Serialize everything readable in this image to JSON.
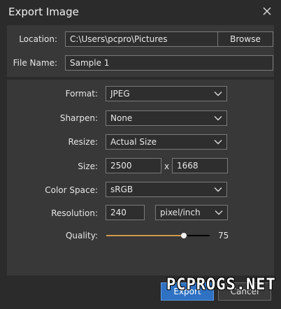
{
  "window": {
    "title": "Export Image"
  },
  "location": {
    "label": "Location:",
    "value": "C:\\Users\\pcpro\\Pictures",
    "browse_label": "Browse"
  },
  "file_name": {
    "label": "File Name:",
    "value": "Sample 1"
  },
  "format": {
    "label": "Format:",
    "value": "JPEG"
  },
  "sharpen": {
    "label": "Sharpen:",
    "value": "None"
  },
  "resize": {
    "label": "Resize:",
    "value": "Actual Size"
  },
  "size": {
    "label": "Size:",
    "width": "2500",
    "separator": "x",
    "height": "1668"
  },
  "color_space": {
    "label": "Color Space:",
    "value": "sRGB"
  },
  "resolution": {
    "label": "Resolution:",
    "value": "240",
    "unit": "pixel/inch"
  },
  "quality": {
    "label": "Quality:",
    "value": "75",
    "level": 0.75
  },
  "buttons": {
    "export_label": "Export",
    "cancel_label": "Cancel"
  },
  "watermark": {
    "text": "PCPROGS.NET"
  },
  "colors": {
    "accent": "#2f72c4",
    "slider_fill": "#d29a4a"
  },
  "icons": {
    "close": "close-icon",
    "dropdown": "chevron-down-icon"
  }
}
